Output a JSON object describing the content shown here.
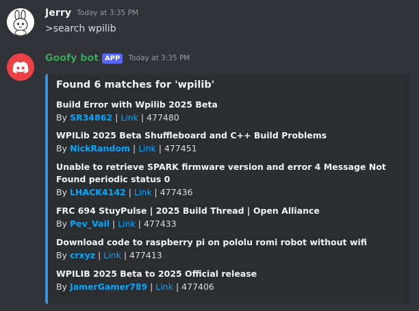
{
  "messages": [
    {
      "username": "Jerry",
      "username_color": "#f2f3f5",
      "timestamp": "Today at 3:35 PM",
      "content": ">search wpilib"
    },
    {
      "username": "Goofy bot",
      "username_color": "#3ba55c",
      "badge": "APP",
      "timestamp": "Today at 3:35 PM",
      "embed": {
        "accent_color": "#3b92db",
        "title": "Found 6 matches for 'wpilib'",
        "results": [
          {
            "title": "Build Error with Wpilib 2025 Beta",
            "by": "By",
            "author": "SR34862",
            "sep1": "|",
            "link": "Link",
            "sep2": "|",
            "id": "477480"
          },
          {
            "title": "WPILib 2025 Beta Shuffleboard and C++ Build Problems",
            "by": "By",
            "author": "NickRandom",
            "sep1": "|",
            "link": "Link",
            "sep2": "|",
            "id": "477451"
          },
          {
            "title": "Unable to retrieve SPARK firmware version and error 4 Message Not Found periodic status 0",
            "by": "By",
            "author": "LHACK4142",
            "sep1": "|",
            "link": "Link",
            "sep2": "|",
            "id": "477436"
          },
          {
            "title": "FRC 694 StuyPulse | 2025 Build Thread | Open Alliance",
            "by": "By",
            "author": "Pev_Vail",
            "sep1": "|",
            "link": "Link",
            "sep2": "|",
            "id": "477433"
          },
          {
            "title": "Download code to raspberry pi on pololu romi robot without wifi",
            "by": "By",
            "author": "crxyz",
            "sep1": "|",
            "link": "Link",
            "sep2": "|",
            "id": "477413"
          },
          {
            "title": "WPILIB 2025 Beta to 2025 Official release",
            "by": "By",
            "author": "JamerGamer789",
            "sep1": "|",
            "link": "Link",
            "sep2": "|",
            "id": "477406"
          }
        ]
      }
    }
  ],
  "icons": {
    "user_avatar": "bunny-avatar-icon",
    "bot_avatar": "discord-logo-icon"
  },
  "colors": {
    "background": "#313338",
    "embed_background": "#2b2d31",
    "link": "#00a8fc",
    "badge": "#5865f2",
    "bot_avatar_bg": "#ed4245"
  }
}
